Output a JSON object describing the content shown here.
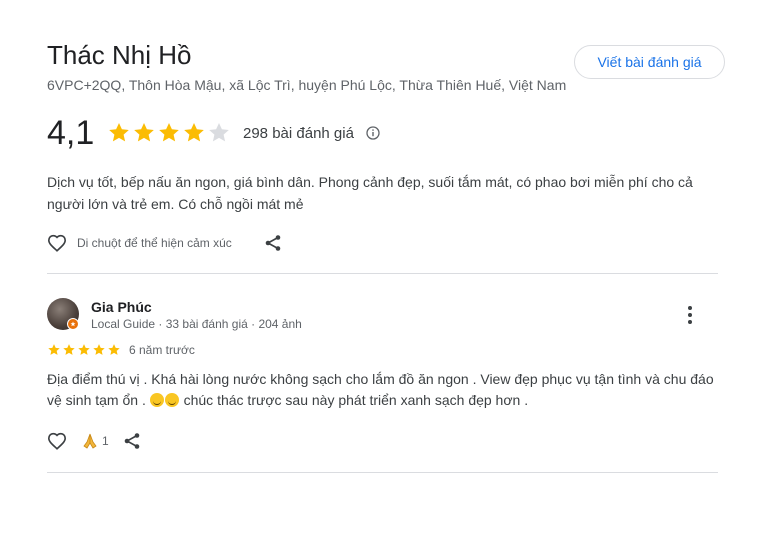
{
  "place": {
    "title": "Thác Nhị Hồ",
    "address": "6VPC+2QQ, Thôn Hòa Mậu, xã Lộc Trì, huyện Phú Lộc, Thừa Thiên Huế, Việt Nam",
    "write_review_label": "Viết bài đánh giá"
  },
  "rating": {
    "value": "4,1",
    "stars": 4.1,
    "count_label": "298 bài đánh giá",
    "star_color": "#fbbc04",
    "empty_star_color": "#dadce0"
  },
  "summary": "Dịch vụ tốt, bếp nấu ăn ngon, giá bình dân. Phong cảnh đẹp, suối tắm mát, có phao bơi miễn phí cho cả người lớn và trẻ em. Có chỗ ngồi mát mẻ",
  "reactions_hint": "Di chuột để thể hiện cảm xúc",
  "review": {
    "reviewer": "Gia Phúc",
    "meta": "Local Guide · 33 bài đánh giá · 204 ảnh",
    "stars": 5,
    "date": "6 năm trước",
    "text_part1": "Địa điểm thú vị . Khá hài lòng nước không sạch cho lắm đồ ăn ngon . View đẹp phục vụ tận tình và chu đáo vệ sinh tạm ổn .",
    "text_part2": "chúc thác trược sau này phát triển xanh sạch đẹp hơn .",
    "reaction_count": "1",
    "emoji_icon": "rolling-laughing-emoji-icon"
  },
  "accent_color": "#1a73e8"
}
